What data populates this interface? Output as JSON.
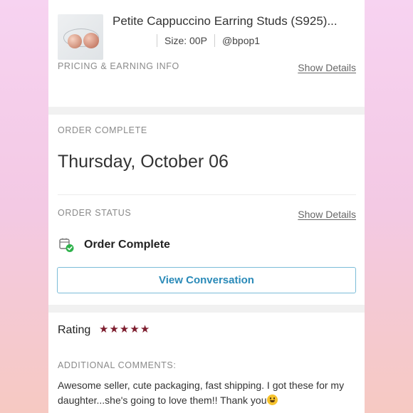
{
  "product": {
    "title": "Petite Cappuccino Earring Studs (S925)...",
    "size": "Size: 00P",
    "seller": "@bpop1"
  },
  "pricing": {
    "label": "PRICING & EARNING INFO",
    "link": "Show Details"
  },
  "order_complete": {
    "label": "ORDER COMPLETE",
    "date": "Thursday, October 06"
  },
  "order_status": {
    "label": "ORDER STATUS",
    "link": "Show Details",
    "status": "Order Complete",
    "icon": "package-check-icon"
  },
  "conversation": {
    "button_label": "View Conversation"
  },
  "rating": {
    "label": "Rating",
    "stars": 5,
    "star_glyph": "★"
  },
  "comments": {
    "label": "ADDITIONAL COMMENTS:",
    "text": "Awesome seller, cute packaging, fast shipping. I got these for my daughter...she's going to love them!! Thank you"
  },
  "colors": {
    "star": "#7d1d2e",
    "button_text": "#2a8ab8",
    "button_border": "#7bbcd8",
    "check_green": "#2eb24b"
  }
}
